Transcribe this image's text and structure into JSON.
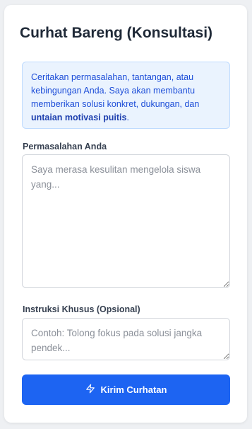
{
  "card": {
    "title": "Curhat Bareng (Konsultasi)"
  },
  "info": {
    "text": "Ceritakan permasalahan, tantangan, atau kebingungan Anda. Saya akan membantu memberikan solusi konkret, dukungan, dan ",
    "highlight": "untaian motivasi puitis",
    "suffix": "."
  },
  "problem_field": {
    "label": "Permasalahan Anda",
    "placeholder": "Saya merasa kesulitan mengelola siswa yang...",
    "value": ""
  },
  "instructions_field": {
    "label": "Instruksi Khusus (Opsional)",
    "placeholder": "Contoh: Tolong fokus pada solusi jangka pendek...",
    "value": ""
  },
  "submit_button": {
    "label": "Kirim Curhatan",
    "icon": "zap-icon",
    "color": "#1d64f2"
  }
}
